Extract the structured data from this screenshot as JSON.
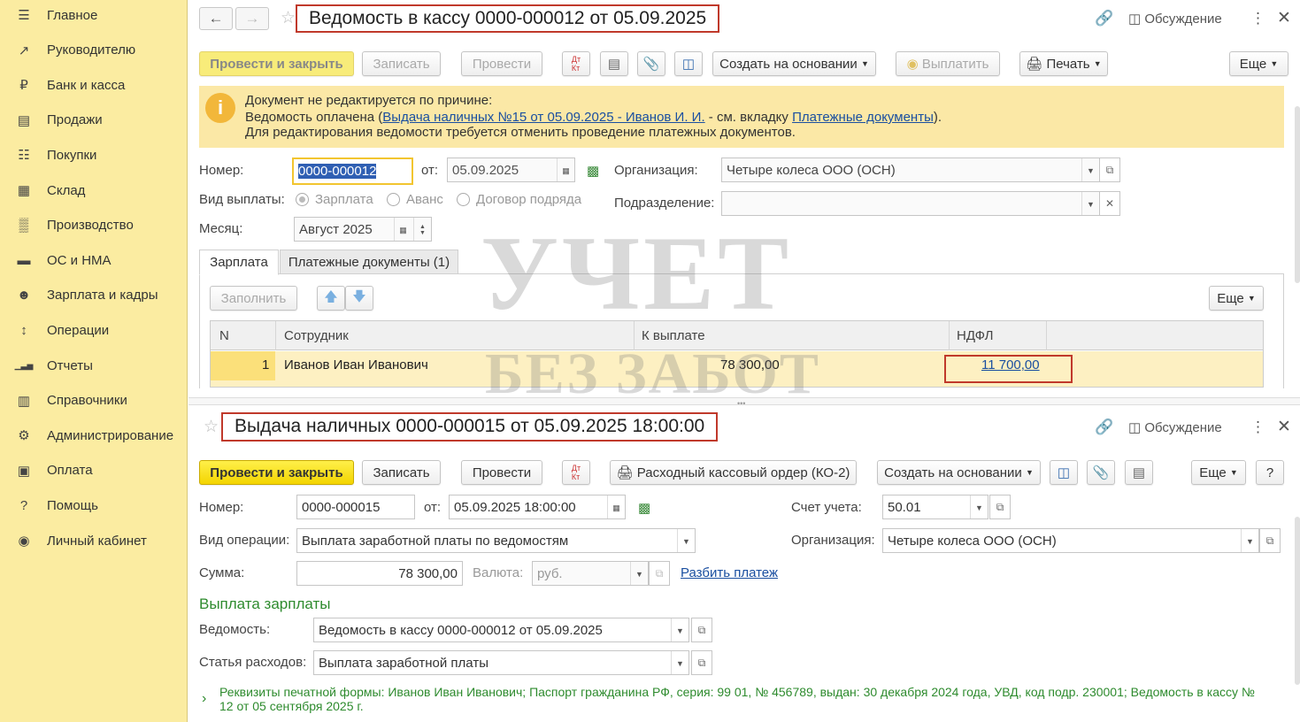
{
  "sidebar": {
    "items": [
      {
        "label": "Главное",
        "icon": "menu-icon"
      },
      {
        "label": "Руководителю",
        "icon": "trend-icon"
      },
      {
        "label": "Банк и касса",
        "icon": "ruble-coin-icon"
      },
      {
        "label": "Продажи",
        "icon": "bag-icon"
      },
      {
        "label": "Покупки",
        "icon": "cart-icon"
      },
      {
        "label": "Склад",
        "icon": "grid-icon"
      },
      {
        "label": "Производство",
        "icon": "factory-icon"
      },
      {
        "label": "ОС и НМА",
        "icon": "truck-icon"
      },
      {
        "label": "Зарплата и кадры",
        "icon": "person-icon"
      },
      {
        "label": "Операции",
        "icon": "dt-kt-icon"
      },
      {
        "label": "Отчеты",
        "icon": "bar-chart-icon"
      },
      {
        "label": "Справочники",
        "icon": "book-icon"
      },
      {
        "label": "Администрирование",
        "icon": "gear-icon"
      },
      {
        "label": "Оплата",
        "icon": "wallet-icon"
      },
      {
        "label": "Помощь",
        "icon": "question-icon"
      },
      {
        "label": "Личный кабинет",
        "icon": "user-circle-icon"
      }
    ]
  },
  "doc1": {
    "title": "Ведомость в кассу 0000-000012 от 05.09.2025",
    "discussion": "Обсуждение",
    "buttons": {
      "post_close": "Провести и закрыть",
      "save": "Записать",
      "post": "Провести",
      "create_based": "Создать на основании",
      "pay": "Выплатить",
      "print": "Печать",
      "more": "Еще"
    },
    "notice": {
      "line1": "Документ не редактируется по причине:",
      "line2_prefix": "Ведомость оплачена (",
      "line2_link": "Выдача наличных №15 от 05.09.2025 - Иванов И. И.",
      "line2_mid": " - см. вкладку ",
      "line2_link2": "Платежные документы",
      "line2_suffix": ").",
      "line3": "Для редактирования ведомости требуется отменить проведение платежных документов."
    },
    "number_label": "Номер:",
    "number": "0000-000012",
    "from_label": "от:",
    "date": "05.09.2025",
    "org_label": "Организация:",
    "org": "Четыре колеса ООО (ОСН)",
    "paytype_label": "Вид выплаты:",
    "paytypes": [
      "Зарплата",
      "Аванс",
      "Договор подряда"
    ],
    "dept_label": "Подразделение:",
    "dept": "",
    "month_label": "Месяц:",
    "month": "Август 2025",
    "tabs": [
      "Зарплата",
      "Платежные документы (1)"
    ],
    "fill": "Заполнить",
    "table_more": "Еще",
    "table": {
      "headers": [
        "N",
        "Сотрудник",
        "К выплате",
        "НДФЛ"
      ],
      "rows": [
        {
          "n": "1",
          "employee": "Иванов Иван Иванович",
          "to_pay": "78 300,00",
          "ndfl": "11 700,00"
        }
      ]
    }
  },
  "doc2": {
    "title": "Выдача наличных 0000-000015 от 05.09.2025 18:00:00",
    "discussion": "Обсуждение",
    "buttons": {
      "post_close": "Провести и закрыть",
      "save": "Записать",
      "post": "Провести",
      "cash_order": "Расходный кассовый ордер (КО-2)",
      "create_based": "Создать на основании",
      "more": "Еще",
      "help": "?"
    },
    "number_label": "Номер:",
    "number": "0000-000015",
    "from_label": "от:",
    "date": "05.09.2025 18:00:00",
    "account_label": "Счет учета:",
    "account": "50.01",
    "optype_label": "Вид операции:",
    "optype": "Выплата заработной платы по ведомостям",
    "org_label": "Организация:",
    "org": "Четыре колеса ООО (ОСН)",
    "sum_label": "Сумма:",
    "sum": "78 300,00",
    "currency_label": "Валюта:",
    "currency": "руб.",
    "split": "Разбить платеж",
    "section": "Выплата зарплаты",
    "statement_label": "Ведомость:",
    "statement": "Ведомость в кассу 0000-000012 от 05.09.2025",
    "expense_label": "Статья расходов:",
    "expense": "Выплата заработной платы",
    "print_details": "Реквизиты печатной формы: Иванов Иван Иванович; Паспорт гражданина РФ, серия: 99 01, № 456789, выдан: 30 декабря 2024 года, УВД, код подр. 230001; Ведомость в кассу № 12 от 05 сентября 2025 г."
  },
  "watermark": {
    "line1": "УЧЕТ",
    "line2": "БЕЗ ЗАБОТ"
  }
}
